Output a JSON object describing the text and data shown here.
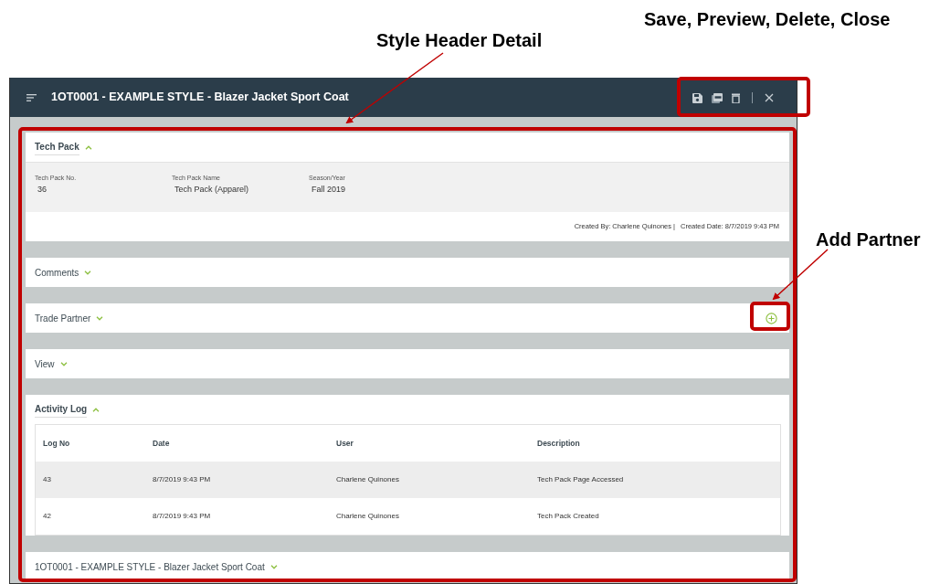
{
  "annotations": [
    {
      "label": "Save, Preview, Delete, Close",
      "kind": "toolbar"
    },
    {
      "label": "Style Header Detail",
      "kind": "content"
    },
    {
      "label": "Add Partner",
      "kind": "partner"
    }
  ],
  "window": {
    "title": "1OT0001 - EXAMPLE STYLE - Blazer Jacket Sport Coat",
    "toolbar": [
      {
        "kind": "save"
      },
      {
        "kind": "pdf"
      },
      {
        "kind": "delete"
      },
      {
        "kind": "close"
      }
    ]
  },
  "sections": [
    {
      "title": "Tech Pack",
      "kind": "fields",
      "expanded": true,
      "fields": [
        {
          "label": "Tech Pack No.",
          "value": "36"
        },
        {
          "label": "Tech Pack Name",
          "value": "Tech Pack (Apparel)"
        },
        {
          "label": "Season/Year",
          "value": "Fall 2019"
        }
      ],
      "created_by": "Created By: Charlene Quinones |",
      "created_date": "Created Date: 8/7/2019 9:43 PM"
    },
    {
      "title": "Comments",
      "kind": "plain",
      "expanded": false
    },
    {
      "title": "Trade Partner",
      "kind": "partner",
      "expanded": false
    },
    {
      "title": "View",
      "kind": "plain",
      "expanded": false
    },
    {
      "title": "Activity Log",
      "kind": "table",
      "expanded": true,
      "columns": [
        "Log No",
        "Date",
        "User",
        "Description"
      ],
      "rows": [
        {
          "cells": [
            "43",
            "8/7/2019 9:43 PM",
            "Charlene Quinones",
            "Tech Pack Page Accessed"
          ]
        },
        {
          "cells": [
            "42",
            "8/7/2019 9:43 PM",
            "Charlene Quinones",
            "Tech Pack Created"
          ]
        }
      ]
    },
    {
      "title": "1OT0001 - EXAMPLE STYLE - Blazer Jacket Sport Coat",
      "kind": "plain",
      "expanded": false
    }
  ]
}
